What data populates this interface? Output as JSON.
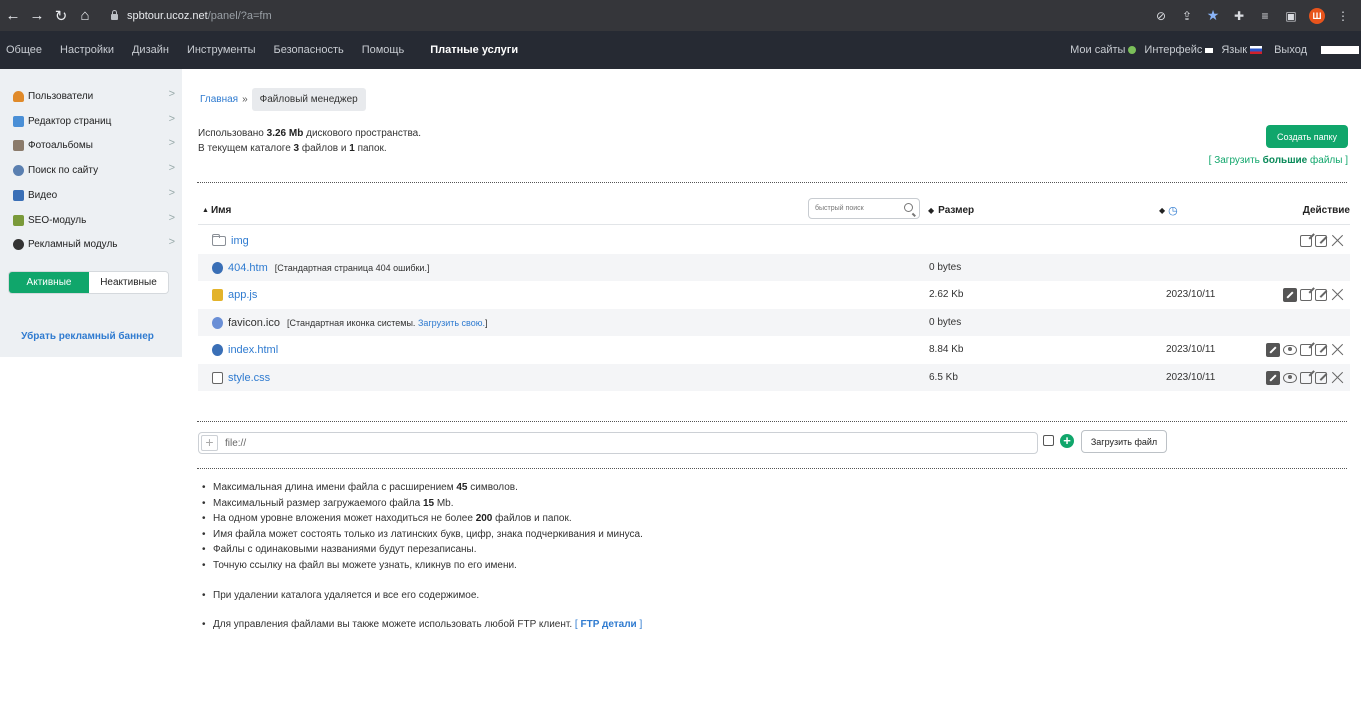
{
  "browser": {
    "url_host": "spbtour.ucoz.net",
    "url_path": "/panel/?a=fm",
    "avatar_letter": "Ш"
  },
  "topmenu": {
    "items": [
      "Общее",
      "Настройки",
      "Дизайн",
      "Инструменты",
      "Безопасность",
      "Помощь"
    ],
    "paid": "Платные услуги",
    "right": {
      "my_sites": "Мои сайты",
      "interface": "Интерфейс",
      "language": "Язык",
      "exit": "Выход"
    }
  },
  "sidebar": {
    "items": [
      {
        "label": "Пользователи",
        "icon": "users-icon",
        "color": "#e08a2a"
      },
      {
        "label": "Редактор страниц",
        "icon": "page-editor-icon",
        "color": "#4a8fd6"
      },
      {
        "label": "Фотоальбомы",
        "icon": "photo-albums-icon",
        "color": "#8b7b6b"
      },
      {
        "label": "Поиск по сайту",
        "icon": "site-search-icon",
        "color": "#5a7fb0"
      },
      {
        "label": "Видео",
        "icon": "video-icon",
        "color": "#3a6fb6"
      },
      {
        "label": "SEO-модуль",
        "icon": "seo-icon",
        "color": "#7a9a3a"
      },
      {
        "label": "Рекламный модуль",
        "icon": "ad-module-icon",
        "color": "#333333"
      }
    ],
    "toggle": {
      "active": "Активные",
      "inactive": "Неактивные"
    },
    "remove_banner": "Убрать рекламный баннер"
  },
  "breadcrumb": {
    "home": "Главная",
    "sep": "»",
    "current": "Файловый менеджер"
  },
  "usage": {
    "line1_pre": "Использовано",
    "used": "3.26 Mb",
    "line1_post": "дискового пространства.",
    "line2_pre": "В текущем каталоге",
    "files": "3",
    "line2_mid": "файлов и",
    "folders": "1",
    "line2_post": "папок."
  },
  "create_folder": "Создать папку",
  "upload_big": {
    "open": "[",
    "pre": "Загрузить",
    "bold": "большие",
    "post": "файлы",
    "close": "]"
  },
  "table": {
    "col_name": "Имя",
    "search_placeholder": "быстрый поиск",
    "col_size": "Размер",
    "col_action": "Действие",
    "rows": [
      {
        "name": "img",
        "desc": "",
        "link": "",
        "size": "",
        "date": "",
        "type": "folder"
      },
      {
        "name": "404.htm",
        "desc": "[Стандартная страница 404 ошибки.]",
        "link": "",
        "size": "0 bytes",
        "date": "",
        "type": "htm"
      },
      {
        "name": "app.js",
        "desc": "",
        "link": "",
        "size": "2.62 Kb",
        "date": "2023/10/11",
        "type": "js"
      },
      {
        "name": "favicon.ico",
        "desc": "[Стандартная иконка системы.",
        "link": "Загрузить свою.",
        "desc_end": "]",
        "size": "0 bytes",
        "date": "",
        "type": "ico"
      },
      {
        "name": "index.html",
        "desc": "",
        "link": "",
        "size": "8.84 Kb",
        "date": "2023/10/11",
        "type": "html"
      },
      {
        "name": "style.css",
        "desc": "",
        "link": "",
        "size": "6.5 Kb",
        "date": "2023/10/11",
        "type": "css"
      }
    ]
  },
  "upload": {
    "placeholder": "file://",
    "button": "Загрузить файл"
  },
  "notes": {
    "n1_pre": "Максимальная длина имени файла с расширением",
    "n1_b": "45",
    "n1_post": "символов.",
    "n2_pre": "Максимальный размер загружаемого файла",
    "n2_b": "15",
    "n2_post": "Mb.",
    "n3_pre": "На одном уровне вложения может находиться не более",
    "n3_b": "200",
    "n3_post": "файлов и папок.",
    "n4": "Имя файла может состоять только из латинских букв, цифр, знака подчеркивания и минуса.",
    "n5": "Файлы с одинаковыми названиями будут перезаписаны.",
    "n6": "Точную ссылку на файл вы можете узнать, кликнув по его имени.",
    "n7": "При удалении каталога удаляется и все его содержимое.",
    "n8_pre": "Для управления файлами вы также можете использовать любой FTP клиент.",
    "n8_open": "[",
    "n8_link": "FTP детали",
    "n8_close": "]"
  },
  "colors": {
    "accent": "#10a66b",
    "link": "#2f7bd0",
    "menu_bg": "#262a33"
  }
}
